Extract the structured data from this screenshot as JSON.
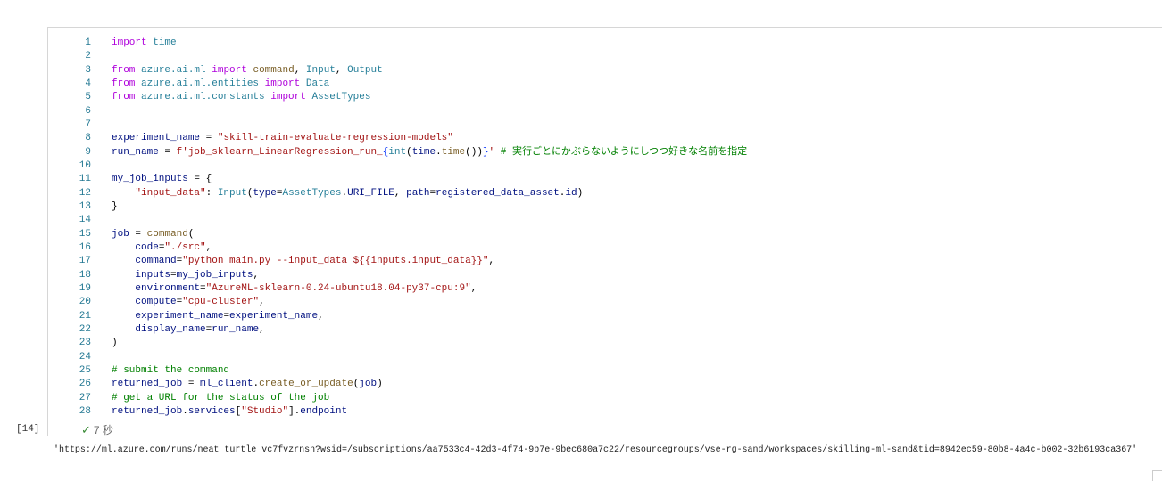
{
  "cell": {
    "execution_count": "[14]",
    "status_duration": "7 秒",
    "status_icon": "check-icon",
    "lines": [
      [
        [
          "k",
          "import"
        ],
        [
          "p",
          " "
        ],
        [
          "m",
          "time"
        ]
      ],
      [],
      [
        [
          "k",
          "from"
        ],
        [
          "p",
          " "
        ],
        [
          "m",
          "azure.ai.ml"
        ],
        [
          "p",
          " "
        ],
        [
          "k",
          "import"
        ],
        [
          "p",
          " "
        ],
        [
          "f",
          "command"
        ],
        [
          "p",
          ", "
        ],
        [
          "c",
          "Input"
        ],
        [
          "p",
          ", "
        ],
        [
          "c",
          "Output"
        ]
      ],
      [
        [
          "k",
          "from"
        ],
        [
          "p",
          " "
        ],
        [
          "m",
          "azure.ai.ml.entities"
        ],
        [
          "p",
          " "
        ],
        [
          "k",
          "import"
        ],
        [
          "p",
          " "
        ],
        [
          "c",
          "Data"
        ]
      ],
      [
        [
          "k",
          "from"
        ],
        [
          "p",
          " "
        ],
        [
          "m",
          "azure.ai.ml.constants"
        ],
        [
          "p",
          " "
        ],
        [
          "k",
          "import"
        ],
        [
          "p",
          " "
        ],
        [
          "c",
          "AssetTypes"
        ]
      ],
      [],
      [],
      [
        [
          "v",
          "experiment_name"
        ],
        [
          "p",
          " = "
        ],
        [
          "s",
          "\"skill-train-evaluate-regression-models\""
        ]
      ],
      [
        [
          "v",
          "run_name"
        ],
        [
          "p",
          " = "
        ],
        [
          "s",
          "f'job_sklearn_LinearRegression_run_"
        ],
        [
          "b",
          "{"
        ],
        [
          "c",
          "int"
        ],
        [
          "p",
          "("
        ],
        [
          "v",
          "time"
        ],
        [
          "p",
          "."
        ],
        [
          "f",
          "time"
        ],
        [
          "p",
          "())"
        ],
        [
          "b",
          "}"
        ],
        [
          "s",
          "'"
        ],
        [
          "p",
          " "
        ],
        [
          "cm",
          "# 実行ごとにかぶらないようにしつつ好きな名前を指定"
        ]
      ],
      [],
      [
        [
          "v",
          "my_job_inputs"
        ],
        [
          "p",
          " = {"
        ]
      ],
      [
        [
          "p",
          "    "
        ],
        [
          "s",
          "\"input_data\""
        ],
        [
          "p",
          ": "
        ],
        [
          "c",
          "Input"
        ],
        [
          "p",
          "("
        ],
        [
          "v",
          "type"
        ],
        [
          "p",
          "="
        ],
        [
          "c",
          "AssetTypes"
        ],
        [
          "p",
          "."
        ],
        [
          "v",
          "URI_FILE"
        ],
        [
          "p",
          ", "
        ],
        [
          "v",
          "path"
        ],
        [
          "p",
          "="
        ],
        [
          "v",
          "registered_data_asset"
        ],
        [
          "p",
          "."
        ],
        [
          "v",
          "id"
        ],
        [
          "p",
          ")"
        ]
      ],
      [
        [
          "p",
          "}"
        ]
      ],
      [],
      [
        [
          "v",
          "job"
        ],
        [
          "p",
          " = "
        ],
        [
          "f",
          "command"
        ],
        [
          "p",
          "("
        ]
      ],
      [
        [
          "p",
          "    "
        ],
        [
          "v",
          "code"
        ],
        [
          "p",
          "="
        ],
        [
          "s",
          "\"./src\""
        ],
        [
          "p",
          ","
        ]
      ],
      [
        [
          "p",
          "    "
        ],
        [
          "v",
          "command"
        ],
        [
          "p",
          "="
        ],
        [
          "s",
          "\"python main.py --input_data ${{inputs.input_data}}\""
        ],
        [
          "p",
          ","
        ]
      ],
      [
        [
          "p",
          "    "
        ],
        [
          "v",
          "inputs"
        ],
        [
          "p",
          "="
        ],
        [
          "v",
          "my_job_inputs"
        ],
        [
          "p",
          ","
        ]
      ],
      [
        [
          "p",
          "    "
        ],
        [
          "v",
          "environment"
        ],
        [
          "p",
          "="
        ],
        [
          "s",
          "\"AzureML-sklearn-0.24-ubuntu18.04-py37-cpu:9\""
        ],
        [
          "p",
          ","
        ]
      ],
      [
        [
          "p",
          "    "
        ],
        [
          "v",
          "compute"
        ],
        [
          "p",
          "="
        ],
        [
          "s",
          "\"cpu-cluster\""
        ],
        [
          "p",
          ","
        ]
      ],
      [
        [
          "p",
          "    "
        ],
        [
          "v",
          "experiment_name"
        ],
        [
          "p",
          "="
        ],
        [
          "v",
          "experiment_name"
        ],
        [
          "p",
          ","
        ]
      ],
      [
        [
          "p",
          "    "
        ],
        [
          "v",
          "display_name"
        ],
        [
          "p",
          "="
        ],
        [
          "v",
          "run_name"
        ],
        [
          "p",
          ","
        ]
      ],
      [
        [
          "p",
          ")"
        ]
      ],
      [],
      [
        [
          "cm",
          "# submit the command"
        ]
      ],
      [
        [
          "v",
          "returned_job"
        ],
        [
          "p",
          " = "
        ],
        [
          "v",
          "ml_client"
        ],
        [
          "p",
          "."
        ],
        [
          "f",
          "create_or_update"
        ],
        [
          "p",
          "("
        ],
        [
          "v",
          "job"
        ],
        [
          "p",
          ")"
        ]
      ],
      [
        [
          "cm",
          "# get a URL for the status of the job"
        ]
      ],
      [
        [
          "v",
          "returned_job"
        ],
        [
          "p",
          "."
        ],
        [
          "v",
          "services"
        ],
        [
          "p",
          "["
        ],
        [
          "s",
          "\"Studio\""
        ],
        [
          "p",
          "]."
        ],
        [
          "v",
          "endpoint"
        ]
      ]
    ]
  },
  "output": {
    "text": "'https://ml.azure.com/runs/neat_turtle_vc7fvzrnsn?wsid=/subscriptions/aa7533c4-42d3-4f74-9b7e-9bec680a7c22/resourcegroups/vse-rg-sand/workspaces/skilling-ml-sand&tid=8942ec59-80b8-4a4c-b002-32b6193ca367'"
  }
}
